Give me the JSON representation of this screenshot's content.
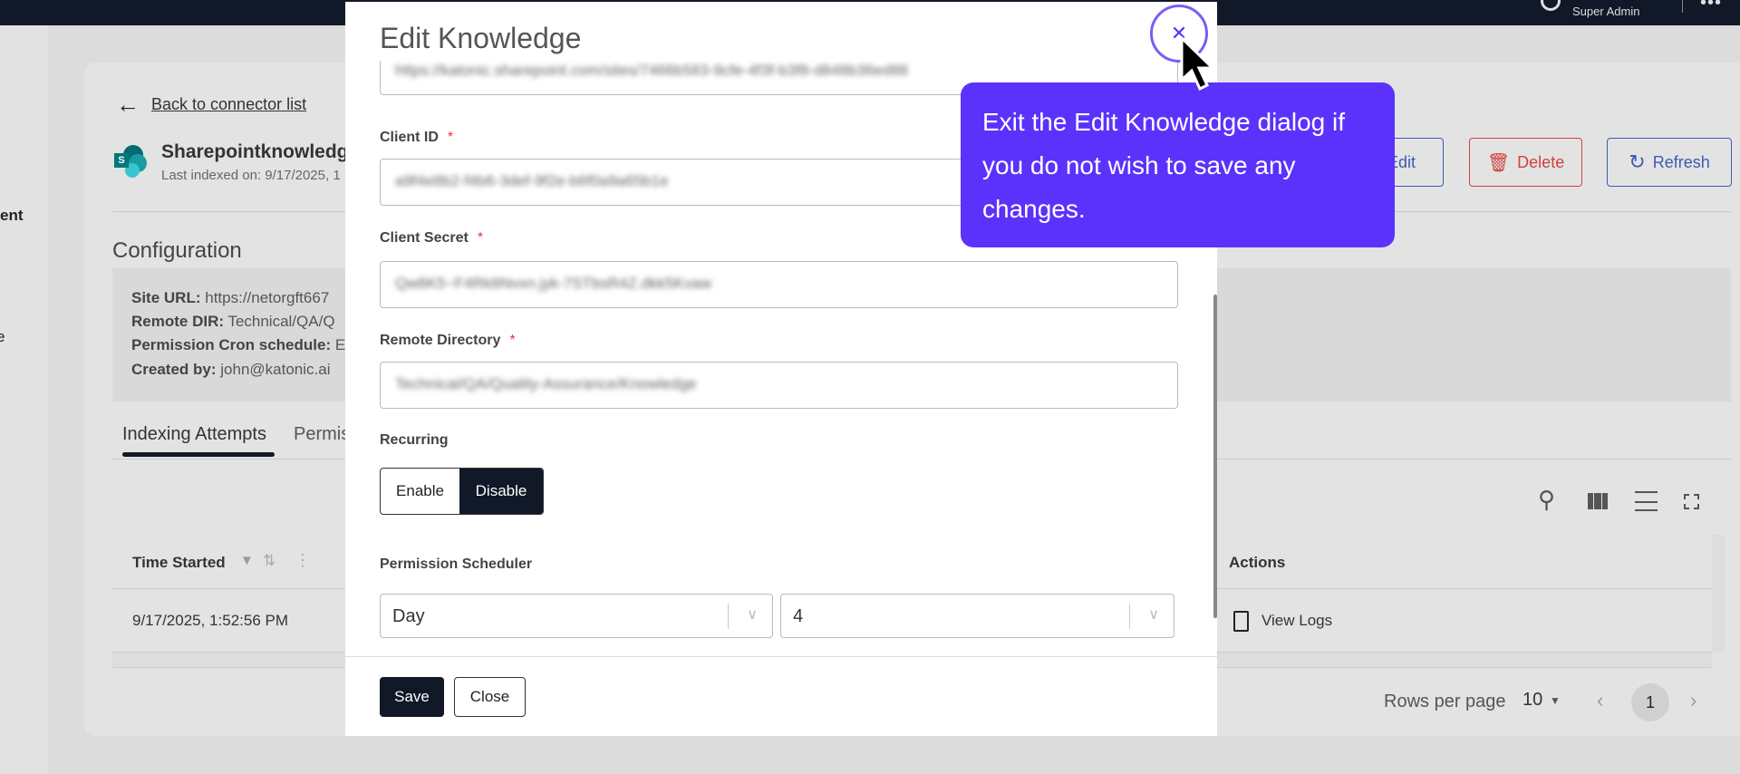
{
  "topbar": {
    "role": "Super Admin",
    "more_icon": "more-dots-icon",
    "avatar_icon": "user-avatar-icon"
  },
  "sidebar": {
    "items": [
      "ent",
      "e"
    ]
  },
  "page": {
    "back_label": "Back to connector list",
    "connector_name": "Sharepointknowledge",
    "last_indexed": "Last indexed on: 9/17/2025, 1",
    "buttons": {
      "edit": "Edit",
      "delete": "Delete",
      "refresh": "Refresh"
    },
    "config_title": "Configuration",
    "config": [
      {
        "key": "Site URL:",
        "value": "https://netorgft667"
      },
      {
        "key": "Remote DIR:",
        "value": "Technical/QA/Q"
      },
      {
        "key": "Permission Cron schedule:",
        "value": "E"
      },
      {
        "key": "Created by:",
        "value": "john@katonic.ai"
      }
    ],
    "tabs": [
      "Indexing Attempts",
      "Permis"
    ],
    "table": {
      "columns": [
        "Time Started",
        "Actions"
      ],
      "rows": [
        {
          "time": "9/17/2025, 1:52:56 PM",
          "action": "View Logs"
        }
      ]
    },
    "pagination": {
      "rows_label": "Rows per page",
      "rows_value": "10",
      "page": "1"
    }
  },
  "modal": {
    "title": "Edit Knowledge",
    "site_url_value": "https://katonic.sharepoint.com/sites/7466b583-9cfe-4f3f-b3f8-d848b36ed88",
    "fields": [
      {
        "label": "Client ID",
        "value": "a9f4e8b2-f4b6-3def-9f2e-b6f0a9a65b1e"
      },
      {
        "label": "Client Secret",
        "value": "Qw8K5~F4Rk8Nvxn.jyk-7STbsR4Z.dkk5Kvaw"
      },
      {
        "label": "Remote Directory",
        "value": "Technical/QA/Quality-Assurance/Knowledge"
      }
    ],
    "required_mark": "*",
    "recurring_label": "Recurring",
    "recurring_options": [
      "Enable",
      "Disable"
    ],
    "recurring_selected": "Disable",
    "scheduler_label": "Permission Scheduler",
    "scheduler_unit": "Day",
    "scheduler_value": "4",
    "save": "Save",
    "close": "Close"
  },
  "tooltip": {
    "text": "Exit the Edit Knowledge dialog if you do not wish to save any changes.",
    "color": "#5b32fb"
  }
}
